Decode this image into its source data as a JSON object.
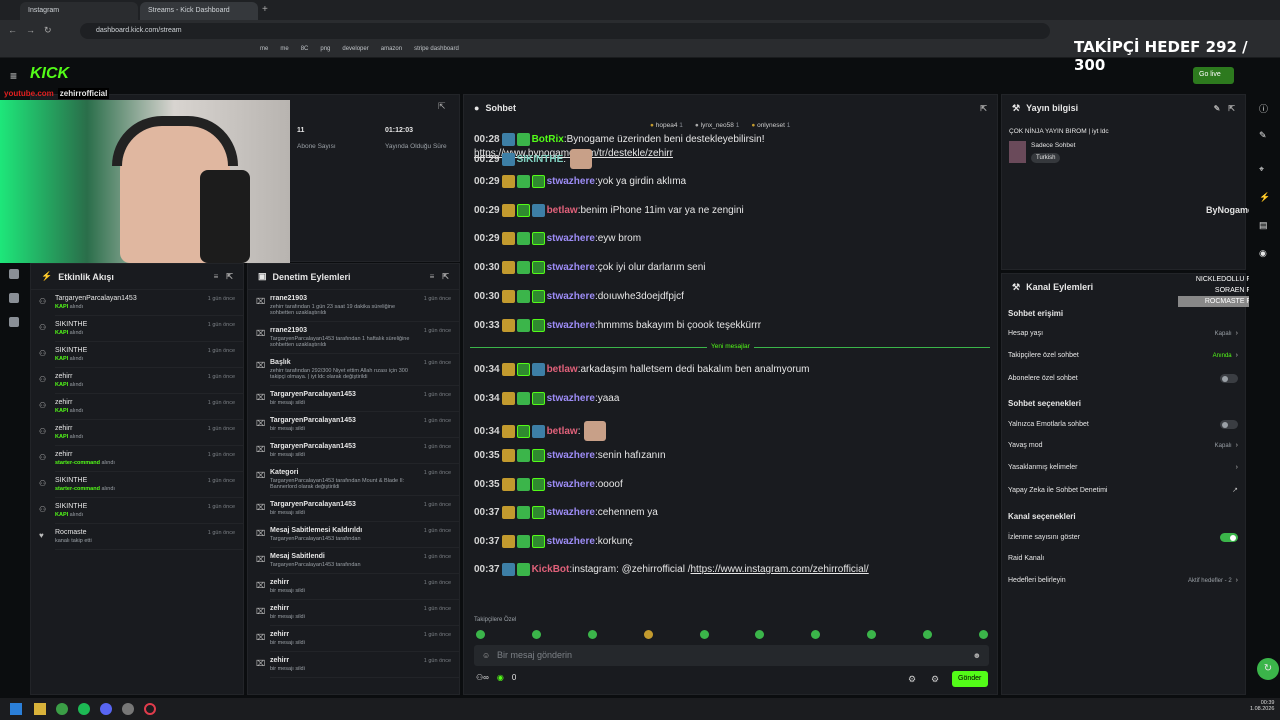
{
  "browser": {
    "tabs": [
      {
        "label": "Instagram"
      },
      {
        "label": "Streams - Kick Dashboard"
      }
    ],
    "url": "dashboard.kick.com/stream",
    "bookmarks": [
      "me",
      "me",
      "8C",
      "png",
      "developer",
      "amazon",
      "stripe dashboard"
    ]
  },
  "overlay": {
    "follower_goal": "TAKİPÇİ HEDEF 292 / 300",
    "streamer_site": "youtube.com",
    "streamer_name": "zehirrofficial",
    "sponsor": "ByNogame",
    "follow_feed": [
      "NICKLEDOLLU FOLLOW",
      "SORAEN FOLLOW",
      "ROCMASTE FOLLOW"
    ]
  },
  "header": {
    "logo": "KICK",
    "go_live": "Go live"
  },
  "stats": {
    "subs_value": "11",
    "subs_label": "Abone Sayısı",
    "uptime_value": "01:12:03",
    "uptime_label": "Yayında Olduğu Süre"
  },
  "activity": {
    "title": "Etkinlik Akışı",
    "items": [
      {
        "user": "TargaryenParcalayan1453",
        "action": "KAPI",
        "suffix": "alındı",
        "time": "1 gün önce"
      },
      {
        "user": "SIKINTHE",
        "action": "KAPI",
        "suffix": "alındı",
        "time": "1 gün önce"
      },
      {
        "user": "SIKINTHE",
        "action": "KAPI",
        "suffix": "alındı",
        "time": "1 gün önce"
      },
      {
        "user": "zehirr",
        "action": "KAPI",
        "suffix": "alındı",
        "time": "1 gün önce"
      },
      {
        "user": "zehirr",
        "action": "KAPI",
        "suffix": "alındı",
        "time": "1 gün önce"
      },
      {
        "user": "zehirr",
        "action": "KAPI",
        "suffix": "alındı",
        "time": "1 gün önce"
      },
      {
        "user": "zehirr",
        "action": "starter-command",
        "suffix": "alındı",
        "time": "1 gün önce"
      },
      {
        "user": "SIKINTHE",
        "action": "starter-command",
        "suffix": "alındı",
        "time": "1 gün önce"
      },
      {
        "user": "SIKINTHE",
        "action": "KAPI",
        "suffix": "alındı",
        "time": "1 gün önce"
      },
      {
        "user": "Rocmaste",
        "action": "",
        "suffix": "kanalı takip etti",
        "time": "1 gün önce"
      }
    ]
  },
  "moderation": {
    "title": "Denetim Eylemleri",
    "items": [
      {
        "title": "rrane21903",
        "detail": "zehirr tarafından 1 gün 23 saat 19 dakika süreliğine sohbetten uzaklaştırıldı",
        "time": "1 gün önce"
      },
      {
        "title": "rrane21903",
        "detail": "TargaryenParcalayan1453 tarafından 1 haftalık süreliğine sohbetten uzaklaştırıldı",
        "time": "1 gün önce"
      },
      {
        "title": "Başlık",
        "detail": "zehirr tarafından 292/300 Niyet ettim Allah rızası için 300 takipçi olmaya. | iyt ldc olarak değiştirildi",
        "time": "1 gün önce"
      },
      {
        "title": "TargaryenParcalayan1453",
        "detail": "bir mesajı sildi",
        "time": "1 gün önce"
      },
      {
        "title": "TargaryenParcalayan1453",
        "detail": "bir mesajı sildi",
        "time": "1 gün önce"
      },
      {
        "title": "TargaryenParcalayan1453",
        "detail": "bir mesajı sildi",
        "time": "1 gün önce"
      },
      {
        "title": "Kategori",
        "detail": "TargaryenParcalayan1453 tarafından Mount & Blade II: Bannerlord olarak değiştirildi",
        "time": "1 gün önce"
      },
      {
        "title": "TargaryenParcalayan1453",
        "detail": "bir mesajı sildi",
        "time": "1 gün önce"
      },
      {
        "title": "Mesaj Sabitlemesi Kaldırıldı",
        "detail": "TargaryenParcalayan1453 tarafından",
        "time": "1 gün önce"
      },
      {
        "title": "Mesaj Sabitlendi",
        "detail": "TargaryenParcalayan1453 tarafından",
        "time": "1 gün önce"
      },
      {
        "title": "zehirr",
        "detail": "bir mesajı sildi",
        "time": "1 gün önce"
      },
      {
        "title": "zehirr",
        "detail": "bir mesajı sildi",
        "time": "1 gün önce"
      },
      {
        "title": "zehirr",
        "detail": "bir mesajı sildi",
        "time": "1 gün önce"
      },
      {
        "title": "zehirr",
        "detail": "bir mesajı sildi",
        "time": "1 gün önce"
      }
    ]
  },
  "chat": {
    "title": "Sohbet",
    "pinned_users": [
      {
        "name": "hopea4",
        "n": "1"
      },
      {
        "name": "lynx_neo58",
        "n": "1"
      },
      {
        "name": "onlyneset",
        "n": "1"
      }
    ],
    "new_messages_label": "Yeni mesajlar",
    "messages": [
      {
        "time": "00:28",
        "user": "BotRix",
        "color": "#53fc18",
        "text": "Bynogame üzerinden beni destekleyebilirsin!",
        "link": "https://www.bynogame.com/tr/destekle/zehirr"
      },
      {
        "time": "00:29",
        "user": "SIKINTHE",
        "color": "#7fd1c0",
        "text": ""
      },
      {
        "time": "00:29",
        "user": "stwazhere",
        "color": "#9d8cf5",
        "text": "yok ya girdin aklıma"
      },
      {
        "time": "00:29",
        "user": "betlaw",
        "color": "#e0617a",
        "text": "benim iPhone 11im var ya ne zengini"
      },
      {
        "time": "00:29",
        "user": "stwazhere",
        "color": "#9d8cf5",
        "text": "eyw brom"
      },
      {
        "time": "00:30",
        "user": "stwazhere",
        "color": "#9d8cf5",
        "text": "çok iyi olur darlarım seni"
      },
      {
        "time": "00:30",
        "user": "stwazhere",
        "color": "#9d8cf5",
        "text": "doıuwhe3doejdfpjcf"
      },
      {
        "time": "00:33",
        "user": "stwazhere",
        "color": "#9d8cf5",
        "text": "hmmms bakayım bi çoook teşekkürrr"
      },
      {
        "time": "00:34",
        "user": "betlaw",
        "color": "#e0617a",
        "text": "arkadaşım halletsem dedi bakalım ben analmyorum"
      },
      {
        "time": "00:34",
        "user": "stwazhere",
        "color": "#9d8cf5",
        "text": "yaaa"
      },
      {
        "time": "00:34",
        "user": "betlaw",
        "color": "#e0617a",
        "text": ""
      },
      {
        "time": "00:35",
        "user": "stwazhere",
        "color": "#9d8cf5",
        "text": "senin hafızanın"
      },
      {
        "time": "00:35",
        "user": "stwazhere",
        "color": "#9d8cf5",
        "text": "oooof"
      },
      {
        "time": "00:37",
        "user": "stwazhere",
        "color": "#9d8cf5",
        "text": "cehennem ya"
      },
      {
        "time": "00:37",
        "user": "stwazhere",
        "color": "#9d8cf5",
        "text": "korkunç"
      },
      {
        "time": "00:37",
        "user": "KickBot",
        "color": "#e0617a",
        "text": "instagram: @zehirrofficial / ",
        "link": "https://www.instagram.com/zehirrofficial/"
      }
    ],
    "followers_only": "Takipçilere Özel",
    "input_placeholder": "Bir mesaj gönderin",
    "points": "0",
    "send": "Gönder"
  },
  "stream_info": {
    "title": "Yayın bilgisi",
    "stream_title": "ÇOK NİNJA YAYIN BIROM | iyt ldc",
    "category": "Sadece Sohbet",
    "tag": "Turkish"
  },
  "channel_actions": {
    "title": "Kanal Eylemleri",
    "chat_access": "Sohbet erişimi",
    "rows1": [
      {
        "label": "Hesap yaşı",
        "value": "Kapalı"
      },
      {
        "label": "Takipçilere özel sohbet",
        "value": "Anında"
      },
      {
        "label": "Abonelere özel sohbet",
        "value": ""
      }
    ],
    "chat_options": "Sohbet seçenekleri",
    "rows2": [
      {
        "label": "Yalnızca Emotlarla sohbet",
        "value": ""
      },
      {
        "label": "Yavaş mod",
        "value": "Kapalı"
      },
      {
        "label": "Yasaklanmış kelimeler",
        "value": ""
      },
      {
        "label": "Yapay Zeka ile Sohbet Denetimi",
        "value": ""
      }
    ],
    "channel_options": "Kanal seçenekleri",
    "rows3": [
      {
        "label": "İzlenme sayısını göster",
        "value": ""
      },
      {
        "label": "Raid Kanalı",
        "value": ""
      },
      {
        "label": "Hedefleri belirleyin",
        "value": "Aktif hedefler - 2"
      }
    ]
  },
  "taskbar": {
    "time": "00:39",
    "date": "1.08.2026"
  },
  "colors": {
    "brand": "#53fc18",
    "panel": "#191b1f",
    "bg": "#0b0d0f"
  }
}
